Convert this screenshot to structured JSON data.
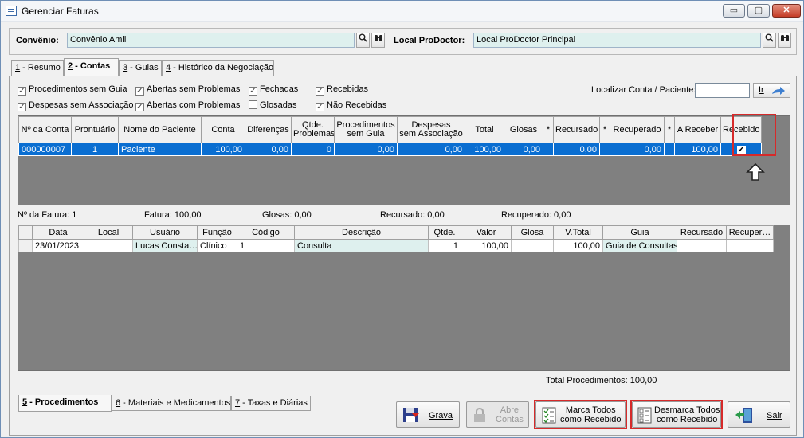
{
  "window": {
    "title": "Gerenciar Faturas",
    "min": "▭",
    "max": "▢",
    "close": "✕"
  },
  "top": {
    "convenio_label": "Convênio:",
    "convenio_value": "Convênio Amil",
    "local_label": "Local ProDoctor:",
    "local_value": "Local ProDoctor Principal",
    "search_icon": "magnifier-icon",
    "find_icon": "binoculars-icon"
  },
  "tabs": [
    {
      "key": "1",
      "label": " - Resumo"
    },
    {
      "key": "2",
      "label": " - Contas"
    },
    {
      "key": "3",
      "label": " - Guias"
    },
    {
      "key": "4",
      "label": " - Histórico da Negociação"
    }
  ],
  "filters": {
    "procedimentos_sem_guia": {
      "label": "Procedimentos sem Guia",
      "checked": true
    },
    "despesas_sem_associacao": {
      "label": "Despesas sem Associação",
      "checked": true
    },
    "abertas_sem_problemas": {
      "label": "Abertas sem Problemas",
      "checked": true
    },
    "abertas_com_problemas": {
      "label": "Abertas com Problemas",
      "checked": true
    },
    "fechadas": {
      "label": "Fechadas",
      "checked": true
    },
    "glosadas": {
      "label": "Glosadas",
      "checked": false
    },
    "recebidas": {
      "label": "Recebidas",
      "checked": true
    },
    "nao_recebidas": {
      "label": "Não Recebidas",
      "checked": true
    }
  },
  "localizar": {
    "label": "Localizar Conta / Paciente:",
    "value": "",
    "go": "Ir"
  },
  "accounts_table": {
    "headers": [
      "Nº da Conta",
      "Prontuário",
      "Nome do Paciente",
      "Conta",
      "Diferenças",
      "Qtde.\nProblemas",
      "Procedimentos\nsem Guia",
      "Despesas\nsem Associação",
      "Total",
      "Glosas",
      "*",
      "Recursado",
      "*",
      "Recuperado",
      "*",
      "A Receber",
      "Recebido"
    ],
    "rows": [
      [
        "000000007",
        "1",
        "Paciente",
        "100,00",
        "0,00",
        "0",
        "0,00",
        "0,00",
        "100,00",
        "0,00",
        "",
        "0,00",
        "",
        "0,00",
        "",
        "100,00",
        "✔"
      ]
    ]
  },
  "summary": {
    "fatura_num": "Nº da Fatura: 1",
    "fatura": "Fatura: 100,00",
    "glosas": "Glosas: 0,00",
    "recursado": "Recursado: 0,00",
    "recuperado": "Recuperado: 0,00"
  },
  "procedures_table": {
    "headers": [
      "",
      "Data",
      "Local",
      "Usuário",
      "Função",
      "Código",
      "Descrição",
      "Qtde.",
      "Valor",
      "Glosa",
      "V.Total",
      "Guia",
      "Recursado",
      "Recuper…"
    ],
    "rows": [
      [
        "",
        "23/01/2023",
        "",
        "Lucas Consta…",
        "Clínico",
        "1",
        "Consulta",
        "1",
        "100,00",
        "",
        "100,00",
        "Guia de Consultas",
        "",
        ""
      ]
    ]
  },
  "total_procedimentos": "Total Procedimentos: 100,00",
  "bottom_tabs": [
    {
      "key": "5",
      "label": " - Procedimentos"
    },
    {
      "key": "6",
      "label": " - Materiais e Medicamentos"
    },
    {
      "key": "7",
      "label": " - Taxas e Diárias"
    }
  ],
  "buttons": {
    "grava": "Grava",
    "abre_contas": "Abre\nContas",
    "marca_todos": "Marca Todos\ncomo Recebido",
    "desmarca_todos": "Desmarca Todos\ncomo Recebido",
    "sair": "Sair"
  },
  "colors": {
    "selection": "#0a6ed1",
    "highlight_box": "#d62a2a",
    "combo_bg": "#def0ee"
  }
}
